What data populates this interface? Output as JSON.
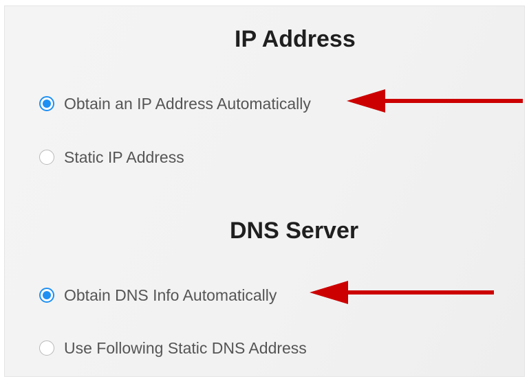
{
  "ip_section": {
    "title": "IP Address",
    "options": [
      {
        "label": "Obtain an IP Address Automatically",
        "selected": true
      },
      {
        "label": "Static IP Address",
        "selected": false
      }
    ]
  },
  "dns_section": {
    "title": "DNS Server",
    "options": [
      {
        "label": "Obtain DNS Info Automatically",
        "selected": true
      },
      {
        "label": "Use Following Static DNS Address",
        "selected": false
      }
    ]
  },
  "colors": {
    "radio_selected": "#1e90f3",
    "annotation_arrow": "#cc0000",
    "title_text": "#1f1f1f",
    "label_text": "#555555"
  },
  "annotations": [
    {
      "type": "arrow",
      "icon": "left-arrow-icon",
      "points_to": "Obtain an IP Address Automatically"
    },
    {
      "type": "arrow",
      "icon": "left-arrow-icon",
      "points_to": "Obtain DNS Info Automatically"
    }
  ]
}
